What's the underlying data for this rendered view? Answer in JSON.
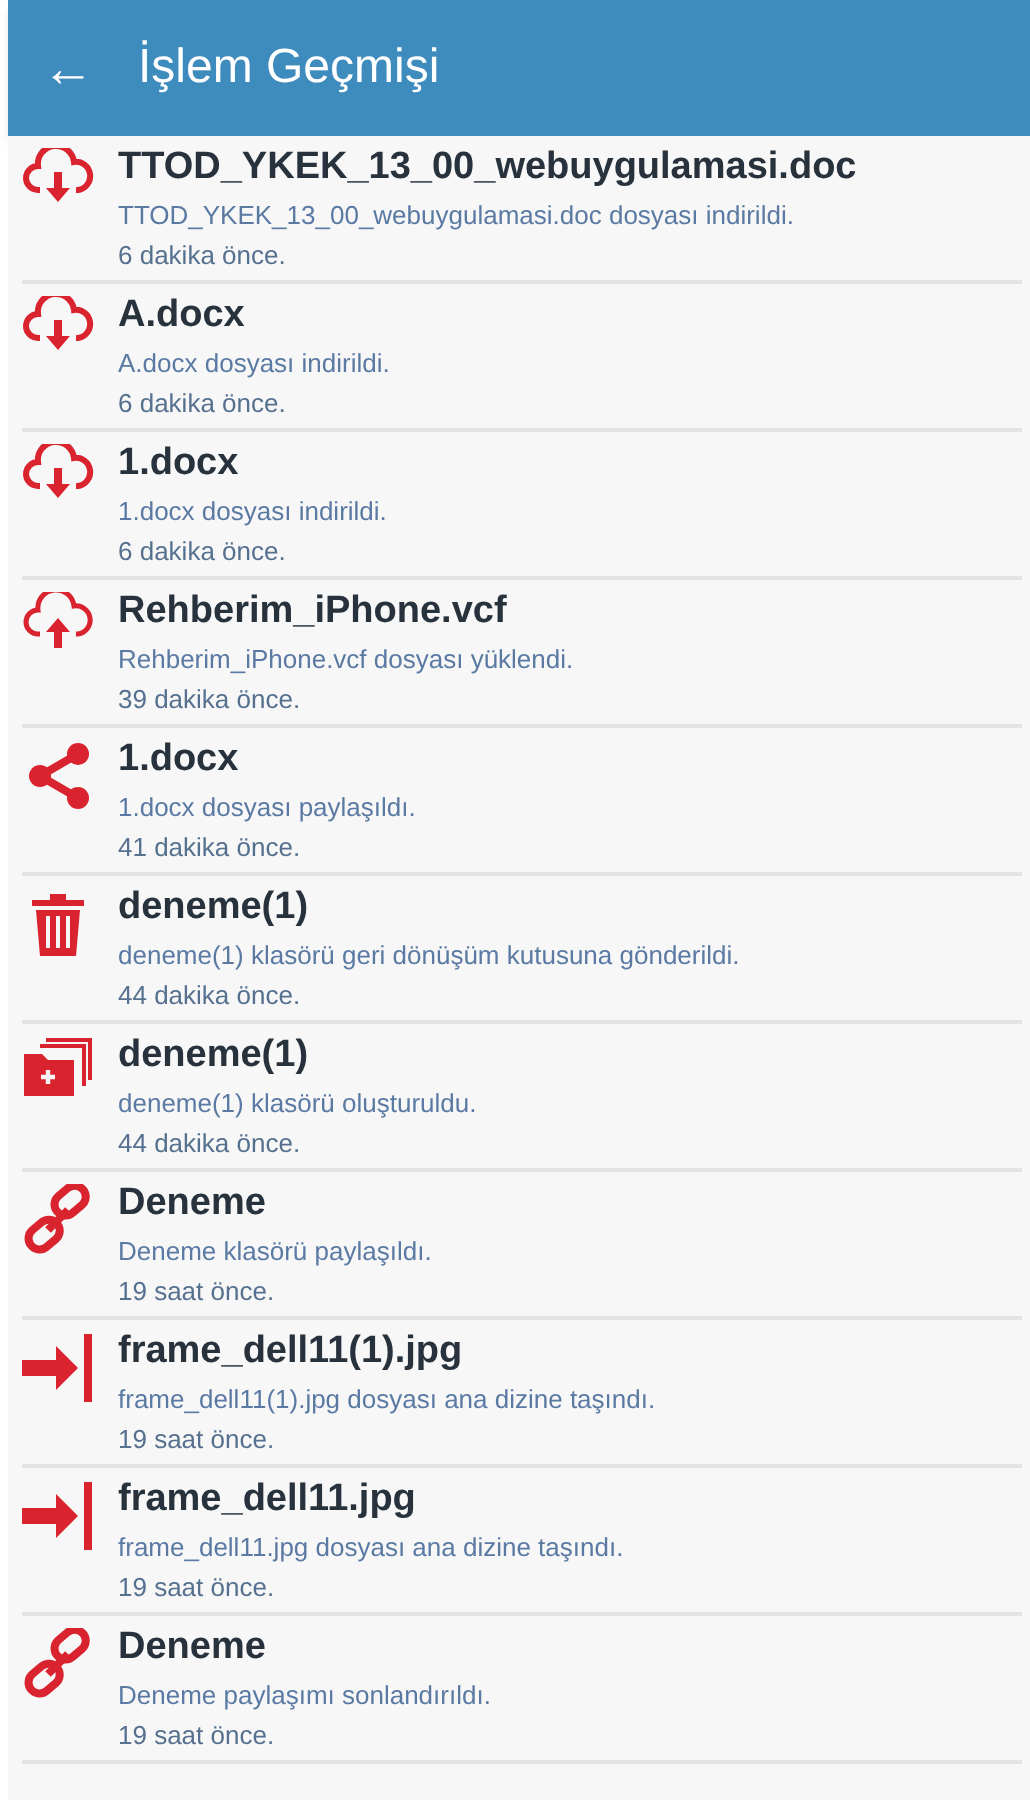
{
  "header": {
    "back_icon": "←",
    "title": "İşlem Geçmişi"
  },
  "items": [
    {
      "kind": "download",
      "title": "TTOD_YKEK_13_00_webuygulamasi.doc",
      "description": "TTOD_YKEK_13_00_webuygulamasi.doc dosyası indirildi.",
      "time": "6 dakika önce."
    },
    {
      "kind": "download",
      "title": "A.docx",
      "description": "A.docx dosyası indirildi.",
      "time": "6 dakika önce."
    },
    {
      "kind": "download",
      "title": "1.docx",
      "description": "1.docx dosyası indirildi.",
      "time": "6 dakika önce."
    },
    {
      "kind": "upload",
      "title": "Rehberim_iPhone.vcf",
      "description": "Rehberim_iPhone.vcf dosyası yüklendi.",
      "time": "39 dakika önce."
    },
    {
      "kind": "share",
      "title": "1.docx",
      "description": "1.docx dosyası paylaşıldı.",
      "time": "41 dakika önce."
    },
    {
      "kind": "trash",
      "title": "deneme(1)",
      "description": "deneme(1) klasörü geri dönüşüm kutusuna gönderildi.",
      "time": "44 dakika önce."
    },
    {
      "kind": "folder",
      "title": "deneme(1)",
      "description": "deneme(1) klasörü oluşturuldu.",
      "time": "44 dakika önce."
    },
    {
      "kind": "link",
      "title": "Deneme",
      "description": "Deneme klasörü paylaşıldı.",
      "time": "19 saat önce."
    },
    {
      "kind": "move",
      "title": "frame_dell11(1).jpg",
      "description": "frame_dell11(1).jpg dosyası ana dizine taşındı.",
      "time": "19 saat önce."
    },
    {
      "kind": "move",
      "title": "frame_dell11.jpg",
      "description": "frame_dell11.jpg dosyası ana dizine taşındı.",
      "time": "19 saat önce."
    },
    {
      "kind": "link",
      "title": "Deneme",
      "description": "Deneme paylaşımı sonlandırıldı.",
      "time": "19 saat önce."
    }
  ]
}
